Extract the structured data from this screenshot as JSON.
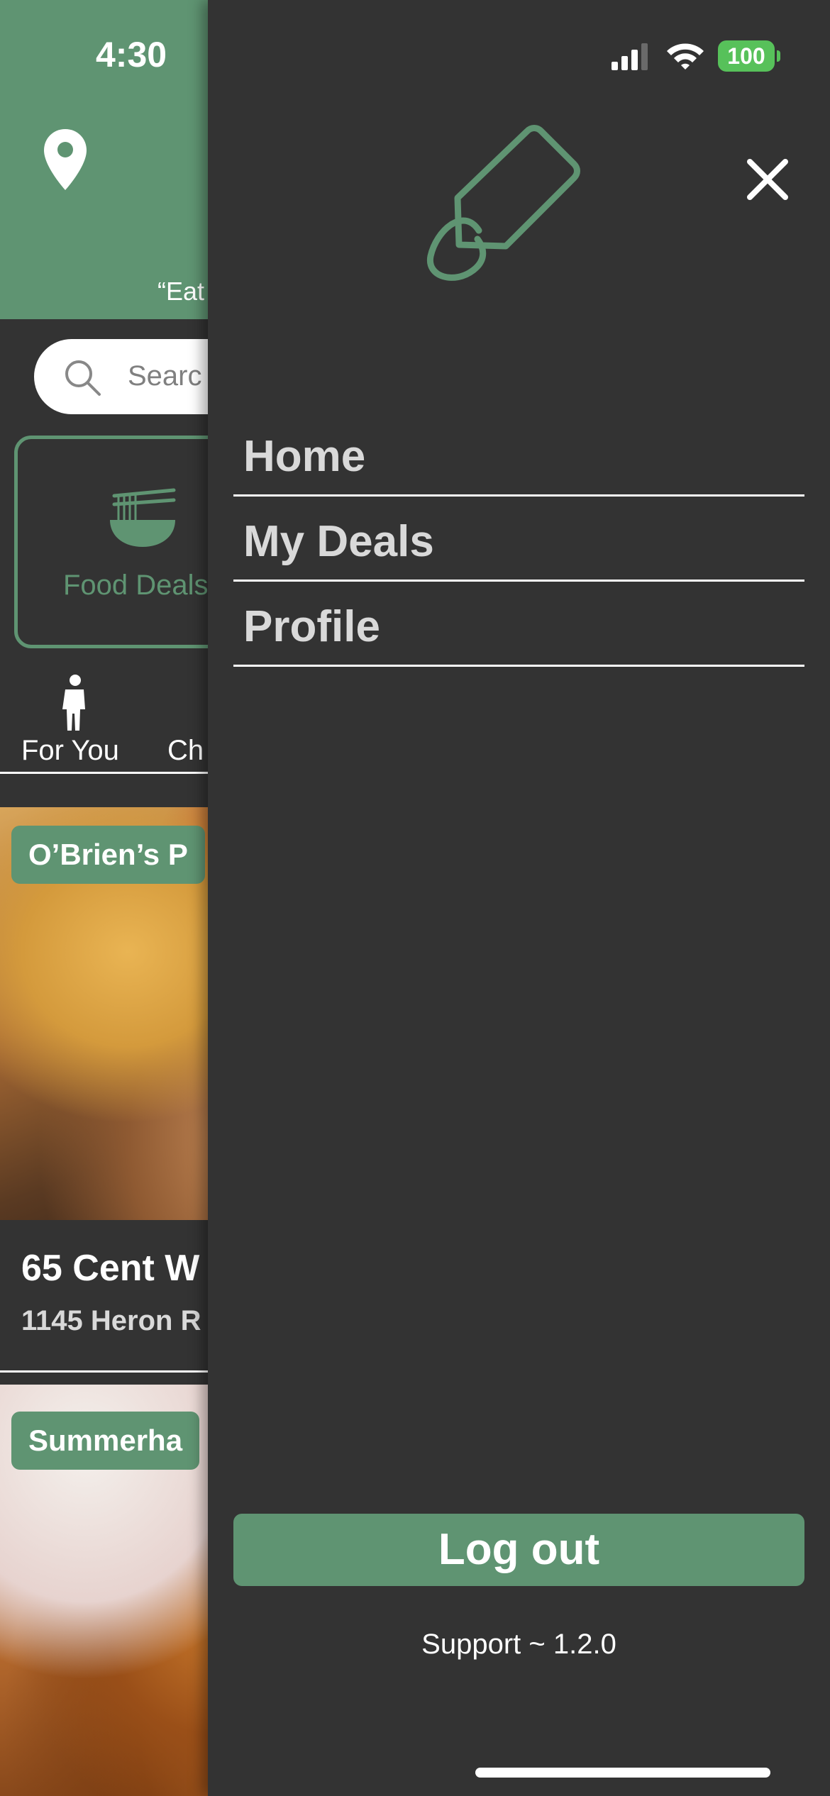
{
  "status_bar": {
    "time": "4:30",
    "battery": "100",
    "colors": {
      "battery": "#57c15a"
    }
  },
  "background_app": {
    "header": {
      "location_icon": "location-pin-icon",
      "tagline": "“Eat"
    },
    "search": {
      "icon": "search-icon",
      "placeholder": "Searc"
    },
    "category": {
      "icon": "noodle-bowl-icon",
      "label": "Food Deals"
    },
    "tabs": [
      {
        "icon": "person-icon",
        "label": "For You"
      },
      {
        "label": "Ch"
      }
    ],
    "deals": [
      {
        "badge": "O’Brien’s P",
        "title": "65 Cent W",
        "address": "1145 Heron R"
      },
      {
        "badge": "Summerha"
      }
    ]
  },
  "drawer": {
    "logo_icon": "price-tag-icon",
    "close_icon": "close-icon",
    "menu": [
      {
        "label": "Home"
      },
      {
        "label": "My Deals"
      },
      {
        "label": "Profile"
      }
    ],
    "logout_label": "Log out",
    "support_text": "Support ~ 1.2.0"
  },
  "colors": {
    "brand_green": "#5f9472",
    "drawer_background": "#333333",
    "menu_text": "#d9d9d9"
  }
}
